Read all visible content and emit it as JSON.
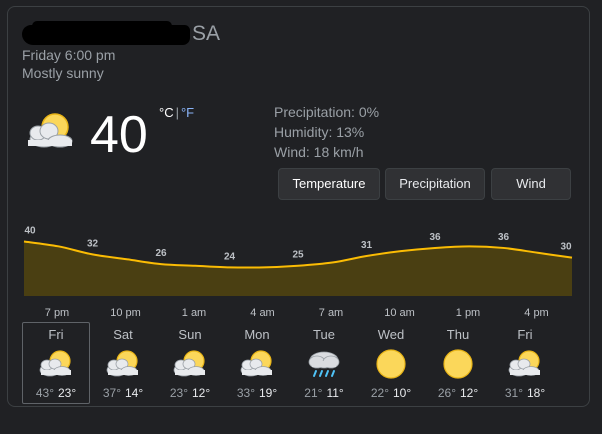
{
  "location": {
    "visible_text": "SA"
  },
  "datetime": "Friday 6:00 pm",
  "condition": "Mostly sunny",
  "current": {
    "temp": "40",
    "unit_c": "°C",
    "separator": "|",
    "unit_f": "°F",
    "icon": "partly-sunny-icon"
  },
  "details": {
    "precipitation": "Precipitation: 0%",
    "humidity": "Humidity: 13%",
    "wind": "Wind: 18 km/h"
  },
  "tabs": [
    {
      "label": "Temperature",
      "active": true
    },
    {
      "label": "Precipitation",
      "active": false
    },
    {
      "label": "Wind",
      "active": false
    }
  ],
  "chart_data": {
    "type": "area",
    "categories": [
      "7 pm",
      "10 pm",
      "1 am",
      "4 am",
      "7 am",
      "10 am",
      "1 pm",
      "4 pm"
    ],
    "x": [
      0,
      0.5,
      1,
      1.5,
      2,
      2.5,
      3,
      3.5,
      4,
      4.5,
      5,
      5.5,
      6,
      6.5,
      7,
      7.5,
      8
    ],
    "values": [
      40,
      37,
      32,
      29,
      26,
      25,
      24,
      24,
      25,
      27,
      31,
      34,
      36,
      37,
      36,
      33,
      30
    ],
    "labels": [
      {
        "x": 0,
        "value": 40
      },
      {
        "x": 1,
        "value": 32
      },
      {
        "x": 2,
        "value": 26
      },
      {
        "x": 3,
        "value": 24
      },
      {
        "x": 4,
        "value": 25
      },
      {
        "x": 5,
        "value": 31
      },
      {
        "x": 6,
        "value": 36
      },
      {
        "x": 7,
        "value": 36
      },
      {
        "x": 8,
        "value": 30
      }
    ],
    "line_color": "#fbbc04",
    "fill_color": "#4a3f12"
  },
  "forecast": [
    {
      "day": "Fri",
      "icon": "partly-sunny-icon",
      "hi": "43°",
      "lo": "23°",
      "selected": true
    },
    {
      "day": "Sat",
      "icon": "partly-sunny-icon",
      "hi": "37°",
      "lo": "14°",
      "selected": false
    },
    {
      "day": "Sun",
      "icon": "partly-sunny-icon",
      "hi": "23°",
      "lo": "12°",
      "selected": false
    },
    {
      "day": "Mon",
      "icon": "partly-sunny-icon",
      "hi": "33°",
      "lo": "19°",
      "selected": false
    },
    {
      "day": "Tue",
      "icon": "rain-icon",
      "hi": "21°",
      "lo": "11°",
      "selected": false
    },
    {
      "day": "Wed",
      "icon": "sun-icon",
      "hi": "22°",
      "lo": "10°",
      "selected": false
    },
    {
      "day": "Thu",
      "icon": "sun-icon",
      "hi": "26°",
      "lo": "12°",
      "selected": false
    },
    {
      "day": "Fri",
      "icon": "partly-sunny-icon",
      "hi": "31°",
      "lo": "18°",
      "selected": false
    }
  ]
}
